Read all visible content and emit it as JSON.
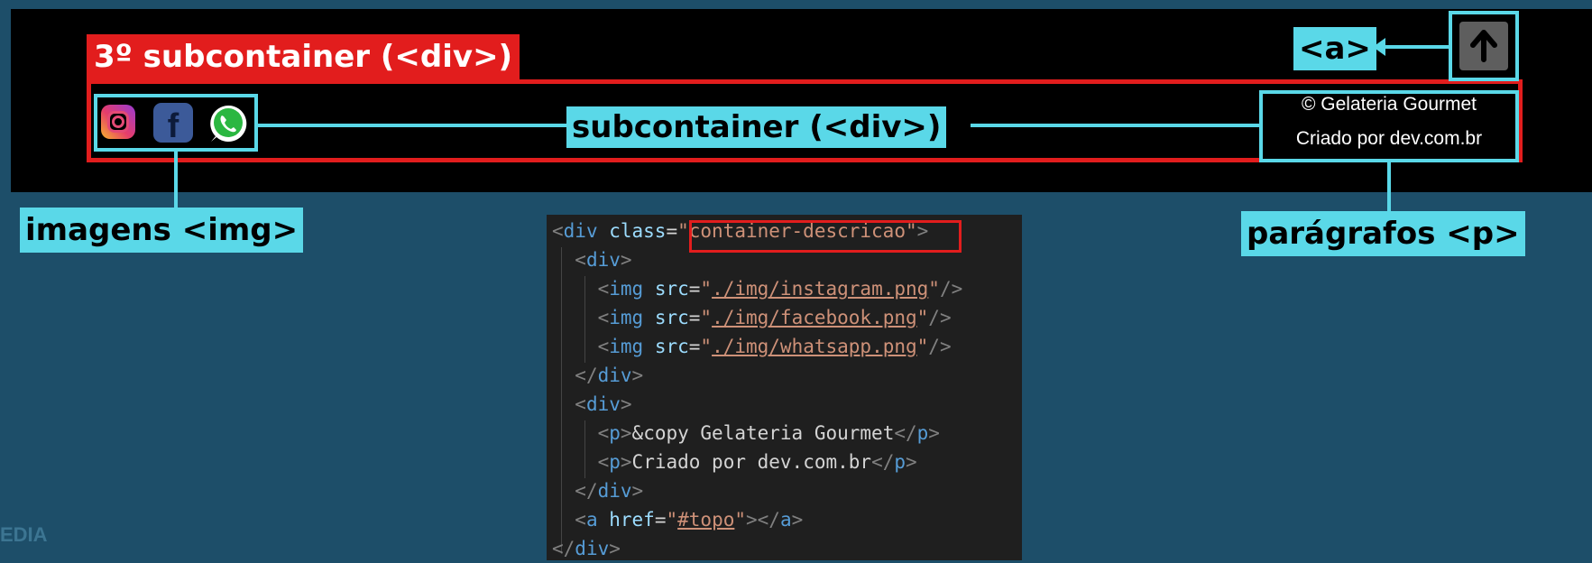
{
  "annotations": {
    "third_subcontainer": "3º subcontainer (<div>)",
    "subcontainer": "subcontainer (<div>)",
    "anchor": "<a>",
    "images": "imagens <img>",
    "paragraphs": "parágrafos <p>"
  },
  "footer": {
    "copyright": "© Gelateria Gourmet",
    "credits": "Criado por dev.com.br",
    "icons": [
      "instagram-icon",
      "facebook-icon",
      "whatsapp-icon",
      "arrow-up-icon"
    ]
  },
  "code": {
    "lines": [
      [
        [
          "tk-punct",
          "<"
        ],
        [
          "tk-tag",
          "div"
        ],
        [
          "tk-attr",
          " class"
        ],
        [
          "tk-txt",
          "="
        ],
        [
          "tk-str",
          "\"container-descricao\""
        ],
        [
          "tk-punct",
          ">"
        ]
      ],
      [
        [
          "tk-txt",
          "  "
        ],
        [
          "tk-punct",
          "<"
        ],
        [
          "tk-tag",
          "div"
        ],
        [
          "tk-punct",
          ">"
        ]
      ],
      [
        [
          "tk-txt",
          "    "
        ],
        [
          "tk-punct",
          "<"
        ],
        [
          "tk-tag",
          "img"
        ],
        [
          "tk-attr",
          " src"
        ],
        [
          "tk-txt",
          "="
        ],
        [
          "tk-str",
          "\""
        ],
        [
          "tk-url",
          "./img/instagram.png"
        ],
        [
          "tk-str",
          "\""
        ],
        [
          "tk-punct",
          "/>"
        ]
      ],
      [
        [
          "tk-txt",
          "    "
        ],
        [
          "tk-punct",
          "<"
        ],
        [
          "tk-tag",
          "img"
        ],
        [
          "tk-attr",
          " src"
        ],
        [
          "tk-txt",
          "="
        ],
        [
          "tk-str",
          "\""
        ],
        [
          "tk-url",
          "./img/facebook.png"
        ],
        [
          "tk-str",
          "\""
        ],
        [
          "tk-punct",
          "/>"
        ]
      ],
      [
        [
          "tk-txt",
          "    "
        ],
        [
          "tk-punct",
          "<"
        ],
        [
          "tk-tag",
          "img"
        ],
        [
          "tk-attr",
          " src"
        ],
        [
          "tk-txt",
          "="
        ],
        [
          "tk-str",
          "\""
        ],
        [
          "tk-url",
          "./img/whatsapp.png"
        ],
        [
          "tk-str",
          "\""
        ],
        [
          "tk-punct",
          "/>"
        ]
      ],
      [
        [
          "tk-txt",
          "  "
        ],
        [
          "tk-punct",
          "</"
        ],
        [
          "tk-tag",
          "div"
        ],
        [
          "tk-punct",
          ">"
        ]
      ],
      [
        [
          "tk-txt",
          "  "
        ],
        [
          "tk-punct",
          "<"
        ],
        [
          "tk-tag",
          "div"
        ],
        [
          "tk-punct",
          ">"
        ]
      ],
      [
        [
          "tk-txt",
          "    "
        ],
        [
          "tk-punct",
          "<"
        ],
        [
          "tk-tag",
          "p"
        ],
        [
          "tk-punct",
          ">"
        ],
        [
          "tk-txt",
          "&copy Gelateria Gourmet"
        ],
        [
          "tk-punct",
          "</"
        ],
        [
          "tk-tag",
          "p"
        ],
        [
          "tk-punct",
          ">"
        ]
      ],
      [
        [
          "tk-txt",
          "    "
        ],
        [
          "tk-punct",
          "<"
        ],
        [
          "tk-tag",
          "p"
        ],
        [
          "tk-punct",
          ">"
        ],
        [
          "tk-txt",
          "Criado por dev.com.br"
        ],
        [
          "tk-punct",
          "</"
        ],
        [
          "tk-tag",
          "p"
        ],
        [
          "tk-punct",
          ">"
        ]
      ],
      [
        [
          "tk-txt",
          "  "
        ],
        [
          "tk-punct",
          "</"
        ],
        [
          "tk-tag",
          "div"
        ],
        [
          "tk-punct",
          ">"
        ]
      ],
      [
        [
          "tk-txt",
          "  "
        ],
        [
          "tk-punct",
          "<"
        ],
        [
          "tk-tag",
          "a"
        ],
        [
          "tk-attr",
          " href"
        ],
        [
          "tk-txt",
          "="
        ],
        [
          "tk-str",
          "\""
        ],
        [
          "tk-url",
          "#topo"
        ],
        [
          "tk-str",
          "\""
        ],
        [
          "tk-punct",
          "></"
        ],
        [
          "tk-tag",
          "a"
        ],
        [
          "tk-punct",
          ">"
        ]
      ],
      [
        [
          "tk-punct",
          "</"
        ],
        [
          "tk-tag",
          "div"
        ],
        [
          "tk-punct",
          ">"
        ]
      ]
    ]
  },
  "watermark": "EDIA",
  "colors": {
    "background": "#1d4e69",
    "annotation_red": "#e21d1d",
    "annotation_cyan": "#5ad8e8"
  }
}
